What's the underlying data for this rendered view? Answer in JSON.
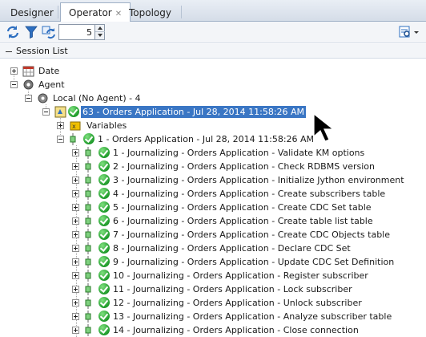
{
  "tabs": [
    {
      "label": "Designer",
      "active": false
    },
    {
      "label": "Operator",
      "active": true
    },
    {
      "label": "Topology",
      "active": false
    }
  ],
  "toolbar": {
    "icons": [
      "refresh-icon",
      "filter-icon",
      "sessions-refresh-icon",
      "search-settings-icon"
    ],
    "spinner_value": "5"
  },
  "section_title": "Session List",
  "tree": {
    "date": "Date",
    "agent": "Agent",
    "local_agent": "Local (No Agent) - 4",
    "session": "63 - Orders Application - Jul 28, 2014 11:58:26 AM",
    "variables": "Variables",
    "step": "1 - Orders Application - Jul 28, 2014 11:58:26 AM",
    "tasks": [
      "1 - Journalizing - Orders Application - Validate KM options",
      "2 - Journalizing - Orders Application - Check RDBMS version",
      "3 - Journalizing - Orders Application - Initialize Jython environment",
      "4 - Journalizing - Orders Application - Create subscribers table",
      "5 - Journalizing - Orders Application - Create CDC Set table",
      "6 - Journalizing - Orders Application - Create table list table",
      "7 - Journalizing - Orders Application - Create CDC Objects table",
      "8 - Journalizing - Orders Application - Declare CDC Set",
      "9 - Journalizing - Orders Application - Update CDC Set Definition",
      "10 - Journalizing - Orders Application - Register subscriber",
      "11 - Journalizing - Orders Application - Lock subscriber",
      "12 - Journalizing - Orders Application - Unlock subscriber",
      "13 - Journalizing - Orders Application - Analyze subscriber table",
      "14 - Journalizing - Orders Application - Close connection"
    ]
  },
  "colors": {
    "selection": "#3a76c4",
    "success": "#1e9a2a"
  }
}
